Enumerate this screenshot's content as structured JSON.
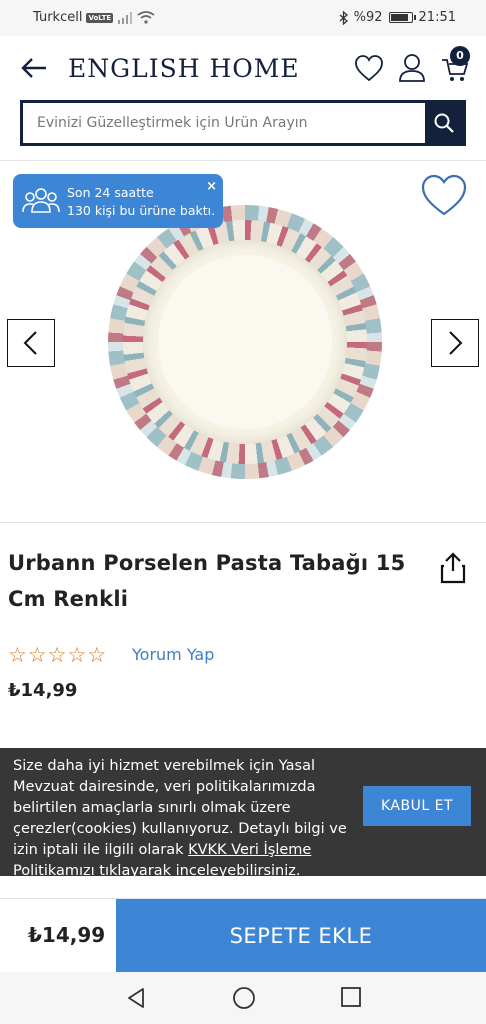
{
  "status_bar": {
    "carrier": "Turkcell",
    "volte": "VoLTE",
    "battery": "%92",
    "battery_level_percent": 92,
    "time": "21:51"
  },
  "header": {
    "brand": "ENGLISH HOME",
    "cart_count": "0"
  },
  "search": {
    "placeholder": "Evinizi Güzelleştirmek için Ürün Arayın"
  },
  "viewers_notice": {
    "line1": "Son 24 saatte",
    "line2": "130 kişi bu ürüne baktı.",
    "close": "×"
  },
  "product": {
    "title": "Urbann Porselen Pasta Tabağı 15 Cm Renkli",
    "rating_stars": 0,
    "review_link": "Yorum Yap",
    "price": "₺14,99"
  },
  "cookie": {
    "text_before": "Size daha iyi hizmet verebilmek için Yasal Mevzuat dairesinde, veri politikalarımızda belirtilen amaçlarla sınırlı olmak üzere çerezler(cookies) kullanıyoruz. Detaylı bilgi ve izin iptali ile ilgili olarak ",
    "link": "KVKK Veri İşleme Politikamızı",
    "text_after": " tıklayarak inceleyebilirsiniz.",
    "accept": "KABUL ET"
  },
  "bottom_bar": {
    "price": "₺14,99",
    "add_to_cart": "SEPETE EKLE"
  },
  "colors": {
    "navy": "#14213d",
    "accent_blue": "#3d86d6",
    "star_orange": "#d07a22",
    "link_blue": "#3b7fc4"
  }
}
